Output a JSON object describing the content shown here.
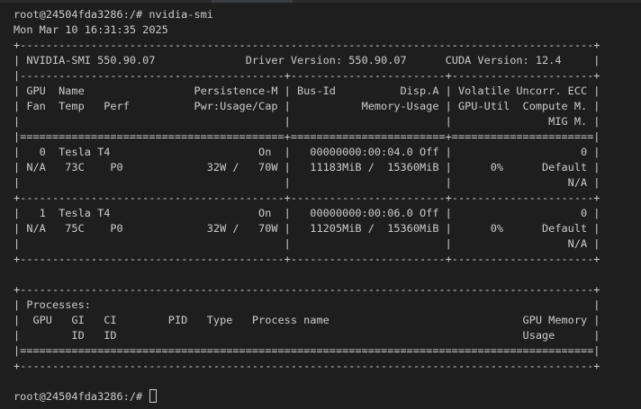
{
  "terminal": {
    "lines": [
      "root@24504fda3286:/# nvidia-smi",
      "Mon Mar 10 16:31:35 2025",
      "+-----------------------------------------------------------------------------------------+",
      "| NVIDIA-SMI 550.90.07              Driver Version: 550.90.07      CUDA Version: 12.4     |",
      "|-----------------------------------------+------------------------+----------------------+",
      "| GPU  Name                 Persistence-M | Bus-Id          Disp.A | Volatile Uncorr. ECC |",
      "| Fan  Temp   Perf          Pwr:Usage/Cap |           Memory-Usage | GPU-Util  Compute M. |",
      "|                                         |                        |               MIG M. |",
      "|=========================================+========================+======================|",
      "|   0  Tesla T4                       On  |   00000000:00:04.0 Off |                    0 |",
      "| N/A   73C    P0             32W /   70W |   11183MiB /  15360MiB |      0%      Default |",
      "|                                         |                        |                  N/A |",
      "+-----------------------------------------+------------------------+----------------------+",
      "|   1  Tesla T4                       On  |   00000000:00:06.0 Off |                    0 |",
      "| N/A   75C    P0             32W /   70W |   11205MiB /  15360MiB |      0%      Default |",
      "|                                         |                        |                  N/A |",
      "+-----------------------------------------+------------------------+----------------------+",
      "",
      "+-----------------------------------------------------------------------------------------+",
      "| Processes:                                                                              |",
      "|  GPU   GI   CI        PID   Type   Process name                              GPU Memory |",
      "|        ID   ID                                                               Usage      |",
      "|=========================================================================================|",
      "+-----------------------------------------------------------------------------------------+"
    ],
    "prompt": "root@24504fda3286:/# "
  }
}
